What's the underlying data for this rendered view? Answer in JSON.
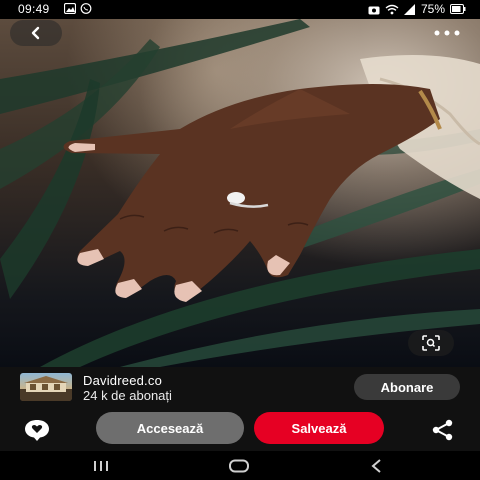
{
  "status_bar": {
    "time": "09:49",
    "battery": "75%"
  },
  "icons": {
    "back": "chevron-left-icon",
    "more": "more-dots-icon",
    "lens": "visual-search-icon",
    "comment": "comment-heart-icon",
    "share": "share-icon"
  },
  "creator": {
    "name": "Davidreed.co",
    "followers": "24 k de abonați",
    "follow_label": "Abonare"
  },
  "actions": {
    "visit_label": "Accesează",
    "save_label": "Salvează"
  },
  "colors": {
    "save_button": "#e60023",
    "visit_button": "#6e6e6e",
    "follow_button": "#3a3a3a"
  }
}
